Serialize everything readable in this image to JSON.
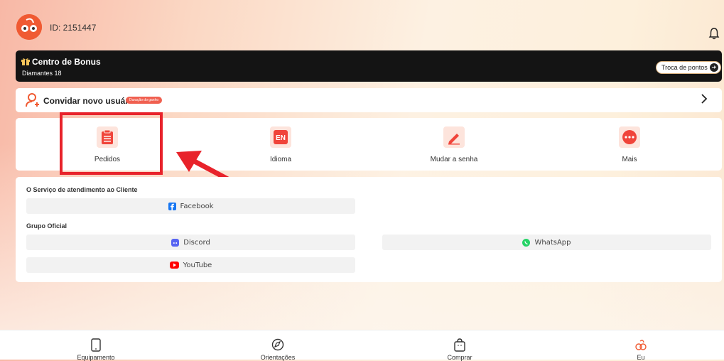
{
  "header": {
    "user_id": "ID: 2151447"
  },
  "bonus": {
    "title": "Centro de Bonus",
    "subtitle": "Diamantes 18",
    "exchange_button": "Troca de pontos"
  },
  "invite": {
    "label": "Convidar novo usuário",
    "badge": "Duração do ganho"
  },
  "actions": [
    {
      "label": "Pedidos",
      "icon": "clipboard-icon"
    },
    {
      "label": "Idioma",
      "icon": "language-en-icon",
      "icon_text": "EN"
    },
    {
      "label": "Mudar a senha",
      "icon": "pencil-icon"
    },
    {
      "label": "Mais",
      "icon": "more-icon"
    }
  ],
  "service": {
    "customer_title": "O Serviço de atendimento ao Cliente",
    "facebook": "Facebook",
    "group_title": "Grupo Oficial",
    "discord": "Discord",
    "whatsapp": "WhatsApp",
    "youtube": "YouTube"
  },
  "bottom_nav": [
    {
      "label": "Equipamento",
      "icon": "device-icon"
    },
    {
      "label": "Orientações",
      "icon": "compass-icon"
    },
    {
      "label": "Comprar",
      "icon": "shopping-bag-icon"
    },
    {
      "label": "Eu",
      "icon": "profile-logo-icon",
      "active": true
    }
  ],
  "colors": {
    "accent": "#f05a32",
    "highlight": "#e8232b",
    "facebook": "#1877f2",
    "discord": "#5865f2",
    "whatsapp": "#25d366",
    "youtube": "#ff0000"
  }
}
